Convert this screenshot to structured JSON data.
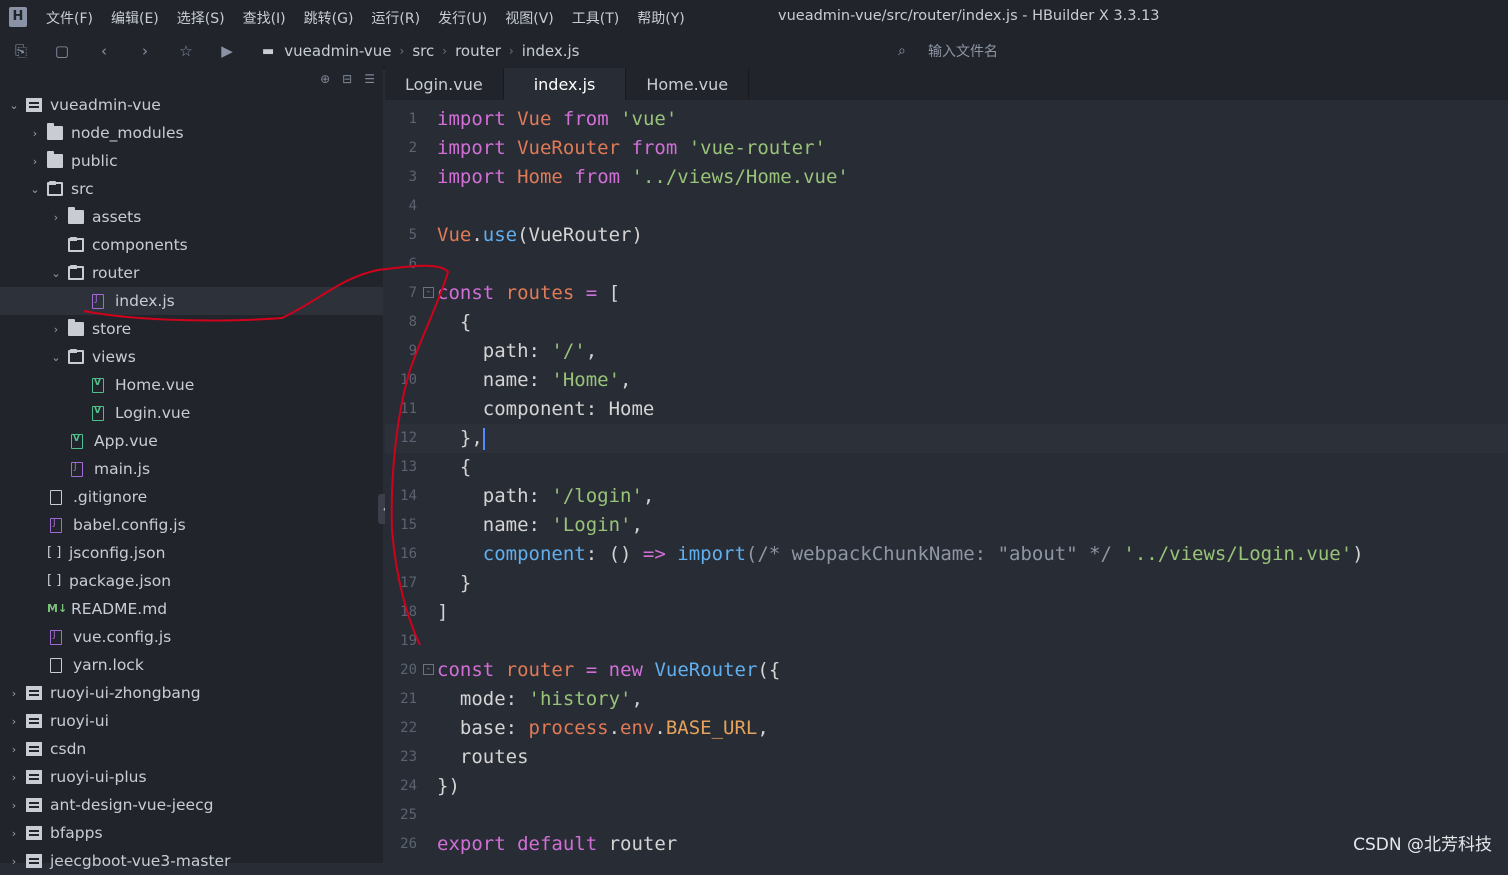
{
  "app": {
    "logo": "H",
    "menu": [
      "文件(F)",
      "编辑(E)",
      "选择(S)",
      "查找(I)",
      "跳转(G)",
      "运行(R)",
      "发行(U)",
      "视图(V)",
      "工具(T)",
      "帮助(Y)"
    ],
    "window_title": "vueadmin-vue/src/router/index.js - HBuilder X 3.3.13"
  },
  "toolbar": {
    "breadcrumb": [
      "vueadmin-vue",
      "src",
      "router",
      "index.js"
    ],
    "search_placeholder": "输入文件名"
  },
  "tree": [
    {
      "label": "vueadmin-vue",
      "depth": 0,
      "icon": "project",
      "expanded": true
    },
    {
      "label": "node_modules",
      "depth": 1,
      "icon": "folder",
      "expanded": false
    },
    {
      "label": "public",
      "depth": 1,
      "icon": "folder",
      "expanded": false
    },
    {
      "label": "src",
      "depth": 1,
      "icon": "folder-open",
      "expanded": true
    },
    {
      "label": "assets",
      "depth": 2,
      "icon": "folder",
      "expanded": false
    },
    {
      "label": "components",
      "depth": 2,
      "icon": "folder-open",
      "expanded": null
    },
    {
      "label": "router",
      "depth": 2,
      "icon": "folder-open",
      "expanded": true
    },
    {
      "label": "index.js",
      "depth": 3,
      "icon": "js",
      "selected": true
    },
    {
      "label": "store",
      "depth": 2,
      "icon": "folder",
      "expanded": false
    },
    {
      "label": "views",
      "depth": 2,
      "icon": "folder-open",
      "expanded": true
    },
    {
      "label": "Home.vue",
      "depth": 3,
      "icon": "vue"
    },
    {
      "label": "Login.vue",
      "depth": 3,
      "icon": "vue"
    },
    {
      "label": "App.vue",
      "depth": 2,
      "icon": "vue"
    },
    {
      "label": "main.js",
      "depth": 2,
      "icon": "js"
    },
    {
      "label": ".gitignore",
      "depth": 1,
      "icon": "file"
    },
    {
      "label": "babel.config.js",
      "depth": 1,
      "icon": "js"
    },
    {
      "label": "jsconfig.json",
      "depth": 1,
      "icon": "json"
    },
    {
      "label": "package.json",
      "depth": 1,
      "icon": "json"
    },
    {
      "label": "README.md",
      "depth": 1,
      "icon": "md"
    },
    {
      "label": "vue.config.js",
      "depth": 1,
      "icon": "js"
    },
    {
      "label": "yarn.lock",
      "depth": 1,
      "icon": "file"
    },
    {
      "label": "ruoyi-ui-zhongbang",
      "depth": 0,
      "icon": "project",
      "expanded": false
    },
    {
      "label": "ruoyi-ui",
      "depth": 0,
      "icon": "project",
      "expanded": false
    },
    {
      "label": "csdn",
      "depth": 0,
      "icon": "project",
      "expanded": false
    },
    {
      "label": "ruoyi-ui-plus",
      "depth": 0,
      "icon": "project",
      "expanded": false
    },
    {
      "label": "ant-design-vue-jeecg",
      "depth": 0,
      "icon": "project",
      "expanded": false
    },
    {
      "label": "bfapps",
      "depth": 0,
      "icon": "project",
      "expanded": false
    },
    {
      "label": "jeecgboot-vue3-master",
      "depth": 0,
      "icon": "project",
      "expanded": false
    }
  ],
  "tabs": [
    {
      "label": "Login.vue",
      "active": false
    },
    {
      "label": "index.js",
      "active": true
    },
    {
      "label": "Home.vue",
      "active": false
    }
  ],
  "code": [
    {
      "n": "1",
      "t": [
        [
          "kw",
          "import"
        ],
        [
          "p",
          " "
        ],
        [
          "cls",
          "Vue"
        ],
        [
          "p",
          " "
        ],
        [
          "kw",
          "from"
        ],
        [
          "p",
          " "
        ],
        [
          "str",
          "'vue'"
        ]
      ]
    },
    {
      "n": "2",
      "t": [
        [
          "kw",
          "import"
        ],
        [
          "p",
          " "
        ],
        [
          "cls",
          "VueRouter"
        ],
        [
          "p",
          " "
        ],
        [
          "kw",
          "from"
        ],
        [
          "p",
          " "
        ],
        [
          "str",
          "'vue-router'"
        ]
      ]
    },
    {
      "n": "3",
      "t": [
        [
          "kw",
          "import"
        ],
        [
          "p",
          " "
        ],
        [
          "cls",
          "Home"
        ],
        [
          "p",
          " "
        ],
        [
          "kw",
          "from"
        ],
        [
          "p",
          " "
        ],
        [
          "str",
          "'../views/Home.vue'"
        ]
      ]
    },
    {
      "n": "4",
      "t": []
    },
    {
      "n": "5",
      "t": [
        [
          "cls",
          "Vue"
        ],
        [
          "p",
          "."
        ],
        [
          "fn",
          "use"
        ],
        [
          "p",
          "(VueRouter)"
        ]
      ]
    },
    {
      "n": "6",
      "t": []
    },
    {
      "n": "7",
      "fold": true,
      "t": [
        [
          "kw",
          "const"
        ],
        [
          "p",
          " "
        ],
        [
          "cls",
          "routes"
        ],
        [
          "p",
          " "
        ],
        [
          "op",
          "="
        ],
        [
          "p",
          " ["
        ]
      ]
    },
    {
      "n": "8",
      "t": [
        [
          "p",
          "  {"
        ]
      ]
    },
    {
      "n": "9",
      "t": [
        [
          "p",
          "    path: "
        ],
        [
          "str",
          "'/'"
        ],
        [
          "p",
          ","
        ]
      ]
    },
    {
      "n": "10",
      "t": [
        [
          "p",
          "    name: "
        ],
        [
          "str",
          "'Home'"
        ],
        [
          "p",
          ","
        ]
      ]
    },
    {
      "n": "11",
      "t": [
        [
          "p",
          "    component: Home"
        ]
      ]
    },
    {
      "n": "12",
      "current": true,
      "t": [
        [
          "p",
          "  },"
        ],
        [
          "cursor",
          ""
        ]
      ]
    },
    {
      "n": "13",
      "t": [
        [
          "p",
          "  {"
        ]
      ]
    },
    {
      "n": "14",
      "t": [
        [
          "p",
          "    path: "
        ],
        [
          "str",
          "'/login'"
        ],
        [
          "p",
          ","
        ]
      ]
    },
    {
      "n": "15",
      "t": [
        [
          "p",
          "    name: "
        ],
        [
          "str",
          "'Login'"
        ],
        [
          "p",
          ","
        ]
      ]
    },
    {
      "n": "16",
      "t": [
        [
          "p",
          "    "
        ],
        [
          "fn",
          "component"
        ],
        [
          "p",
          ": () "
        ],
        [
          "op",
          "=>"
        ],
        [
          "p",
          " "
        ],
        [
          "fn",
          "import"
        ],
        [
          "cmt",
          "(/* webpackChunkName: \"about\" */"
        ],
        [
          "p",
          " "
        ],
        [
          "str",
          "'../views/Login.vue'"
        ],
        [
          "p",
          ")"
        ]
      ]
    },
    {
      "n": "17",
      "t": [
        [
          "p",
          "  }"
        ]
      ]
    },
    {
      "n": "18",
      "t": [
        [
          "p",
          "]"
        ]
      ]
    },
    {
      "n": "19",
      "t": []
    },
    {
      "n": "20",
      "fold": true,
      "t": [
        [
          "kw",
          "const"
        ],
        [
          "p",
          " "
        ],
        [
          "cls",
          "router"
        ],
        [
          "p",
          " "
        ],
        [
          "op",
          "="
        ],
        [
          "p",
          " "
        ],
        [
          "kw",
          "new"
        ],
        [
          "p",
          " "
        ],
        [
          "fn",
          "VueRouter"
        ],
        [
          "p",
          "({"
        ]
      ]
    },
    {
      "n": "21",
      "t": [
        [
          "p",
          "  mode: "
        ],
        [
          "str",
          "'history'"
        ],
        [
          "p",
          ","
        ]
      ]
    },
    {
      "n": "22",
      "t": [
        [
          "p",
          "  base: "
        ],
        [
          "cls",
          "process"
        ],
        [
          "p",
          "."
        ],
        [
          "cls",
          "env"
        ],
        [
          "p",
          "."
        ],
        [
          "const",
          "BASE_URL"
        ],
        [
          "p",
          ","
        ]
      ]
    },
    {
      "n": "23",
      "t": [
        [
          "p",
          "  routes"
        ]
      ]
    },
    {
      "n": "24",
      "t": [
        [
          "p",
          "})"
        ]
      ]
    },
    {
      "n": "25",
      "t": []
    },
    {
      "n": "26",
      "t": [
        [
          "kw",
          "export"
        ],
        [
          "p",
          " "
        ],
        [
          "kw",
          "default"
        ],
        [
          "p",
          " router"
        ]
      ]
    }
  ],
  "watermark": "CSDN @北芳科技",
  "colors": {
    "keyword": "#d16fd6",
    "class": "#e07a57",
    "string": "#98c379",
    "function": "#61afef",
    "annotation": "#d0021b"
  }
}
